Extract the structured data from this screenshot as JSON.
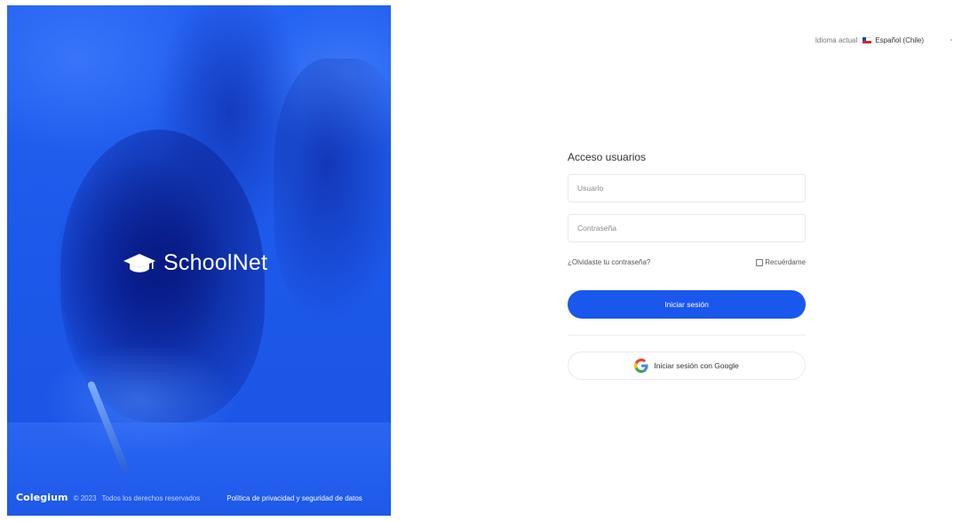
{
  "hero": {
    "brand_name": "SchoolNet",
    "brand_icon": "graduation-cap-icon",
    "footer": {
      "company": "Colegium",
      "copyright": "© 2023",
      "rights": "Todos los derechos reservados",
      "privacy_link": "Política de privacidad y seguridad de datos"
    },
    "background_color": "#1f5ff0"
  },
  "language": {
    "label": "Idioma actual",
    "flag_icon": "chile-flag-icon",
    "value": "Español (Chile)"
  },
  "login": {
    "title": "Acceso usuarios",
    "username_placeholder": "Usuario",
    "password_placeholder": "Contraseña",
    "forgot_password": "¿Olvidaste tu contraseña?",
    "remember_me": "Recuérdame",
    "submit_label": "Iniciar sesión",
    "google_label": "Iniciar sesión con Google",
    "google_icon": "google-icon",
    "accent_color": "#1a57ec"
  }
}
